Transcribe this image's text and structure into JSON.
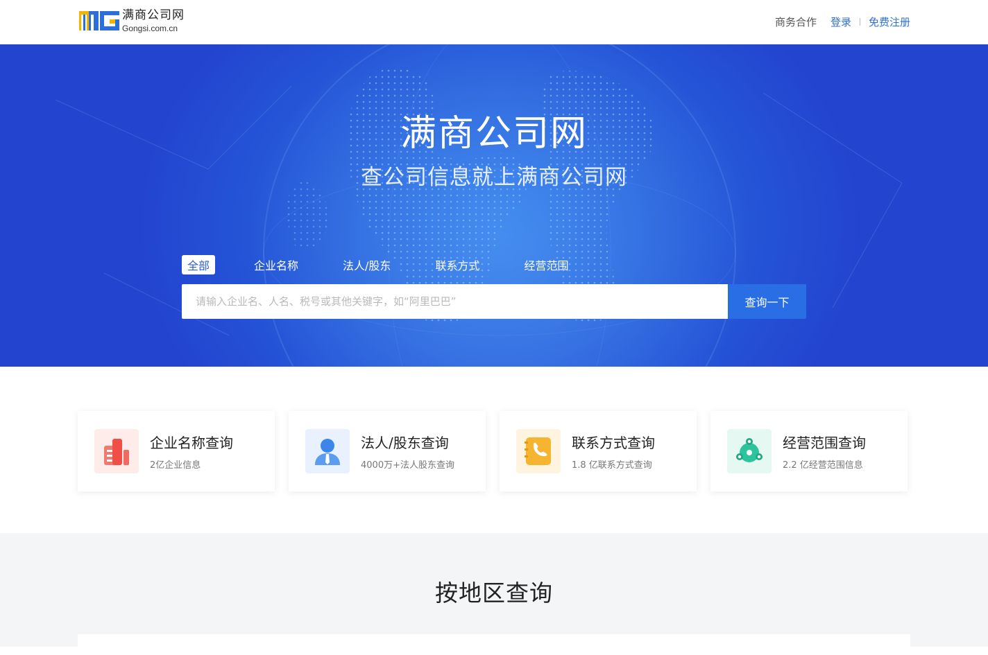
{
  "header": {
    "logo_name": "满商公司网",
    "logo_domain": "Gongsi.com.cn",
    "nav_business": "商务合作",
    "nav_login": "登录",
    "nav_register": "免费注册"
  },
  "hero": {
    "title": "满商公司网",
    "subtitle": "查公司信息就上满商公司网",
    "tabs": [
      "全部",
      "企业名称",
      "法人/股东",
      "联系方式",
      "经营范围"
    ],
    "active_tab": "全部",
    "search_placeholder": "请输入企业名、人名、税号或其他关键字，如“阿里巴巴”",
    "search_button": "查询一下"
  },
  "features": [
    {
      "title": "企业名称查询",
      "desc": "2亿企业信息",
      "icon": "building-icon",
      "color": "#f0574f"
    },
    {
      "title": "法人/股东查询",
      "desc": "4000万+法人股东查询",
      "icon": "person-icon",
      "color": "#3b86e8"
    },
    {
      "title": "联系方式查询",
      "desc": "1.8 亿联系方式查询",
      "icon": "phone-book-icon",
      "color": "#f6b530"
    },
    {
      "title": "经营范围查询",
      "desc": "2.2 亿经营范围信息",
      "icon": "network-icon",
      "color": "#2ec49b"
    }
  ],
  "region": {
    "title": "按地区查询"
  },
  "colors": {
    "brand_blue": "#2a6ee6",
    "link_blue": "#2f6fd8",
    "hero_blue": "#2452d6"
  }
}
